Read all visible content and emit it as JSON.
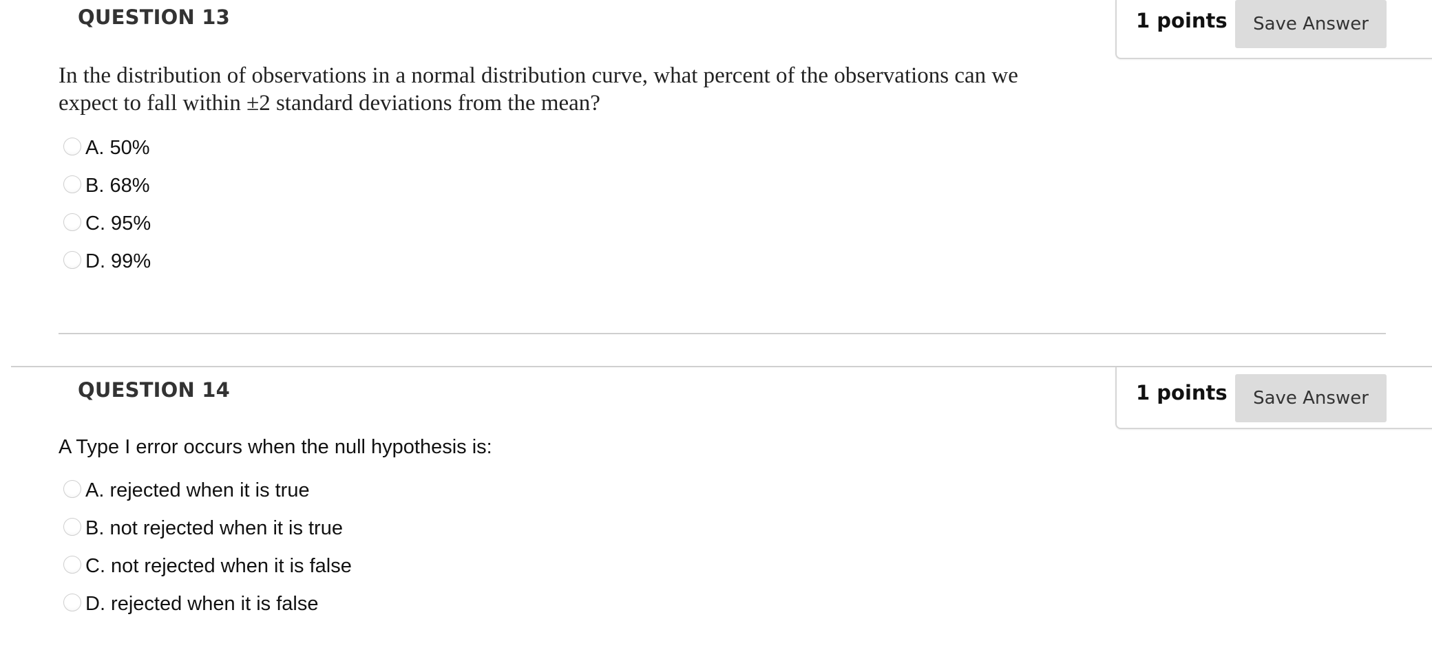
{
  "questions": [
    {
      "title": "QUESTION 13",
      "points": "1 points",
      "save_label": "Save Answer",
      "text": "In the distribution of observations in a normal distribution curve, what percent of the observations can we expect to fall within ±2 standard deviations from the mean?",
      "options": [
        {
          "label": "A. 50%",
          "selected": false
        },
        {
          "label": "B. 68%",
          "selected": false
        },
        {
          "label": "C. 95%",
          "selected": false
        },
        {
          "label": "D. 99%",
          "selected": false
        }
      ]
    },
    {
      "title": "QUESTION 14",
      "points": "1 points",
      "save_label": "Save Answer",
      "text": "A Type I error occurs when the null hypothesis is:",
      "options": [
        {
          "label": "A. rejected when it is true",
          "selected": false
        },
        {
          "label": "B. not rejected when it is true",
          "selected": false
        },
        {
          "label": "C. not rejected when it is false",
          "selected": false
        },
        {
          "label": "D. rejected when it is false",
          "selected": false
        }
      ]
    }
  ]
}
